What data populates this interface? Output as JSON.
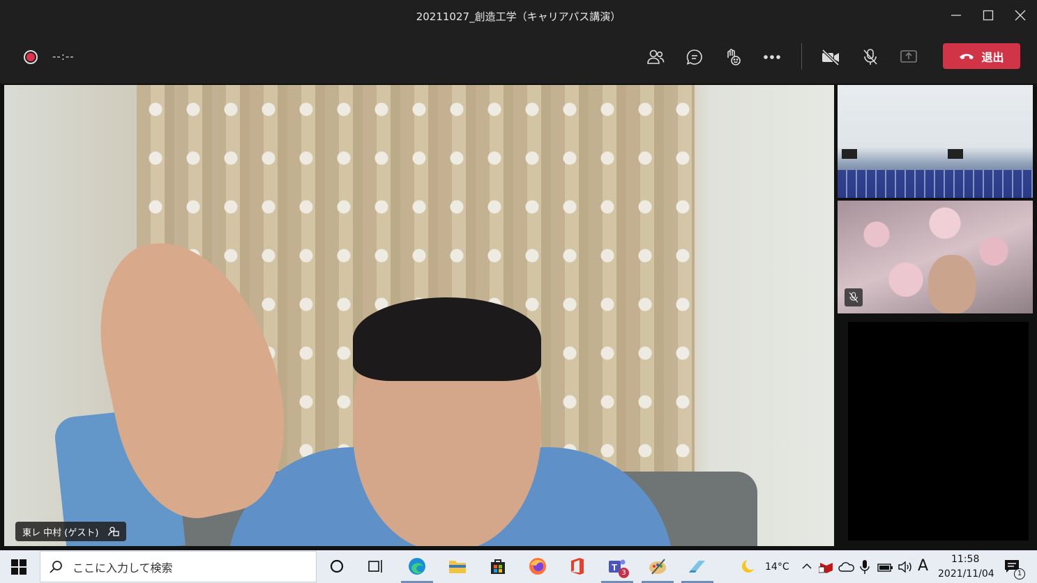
{
  "window": {
    "title": "20211027_創造工学（キャリアパス講演）"
  },
  "toolbar": {
    "recording_timer": "--:--",
    "leave_label": "退出"
  },
  "main_video": {
    "participant_name": "東レ 中村 (ゲスト)"
  },
  "taskbar": {
    "search_placeholder": "ここに入力して検索",
    "teams_badge": "3",
    "weather_temp": "14°C",
    "ime_indicator": "A",
    "clock_time": "11:58",
    "clock_date": "2021/11/04",
    "notification_count": "1"
  },
  "colors": {
    "leave_button": "#d13447",
    "record_dot": "#e0324b",
    "titlebar": "#1f1f1f",
    "taskbar": "#e8edf3"
  },
  "icons": [
    "record-icon",
    "participants-icon",
    "chat-icon",
    "reactions-icon",
    "more-icon",
    "camera-off-icon",
    "mic-off-icon",
    "share-icon",
    "hangup-icon",
    "minimize-icon",
    "maximize-icon",
    "close-icon",
    "windows-start-icon",
    "search-icon",
    "cortana-icon",
    "task-view-icon",
    "edge-icon",
    "file-explorer-icon",
    "store-icon",
    "firefox-icon",
    "office-icon",
    "teams-icon",
    "paint-icon",
    "eraser-app-icon",
    "weather-icon",
    "chevron-up-icon",
    "mcafee-icon",
    "onedrive-icon",
    "microphone-icon",
    "battery-icon",
    "volume-icon",
    "notification-icon"
  ]
}
